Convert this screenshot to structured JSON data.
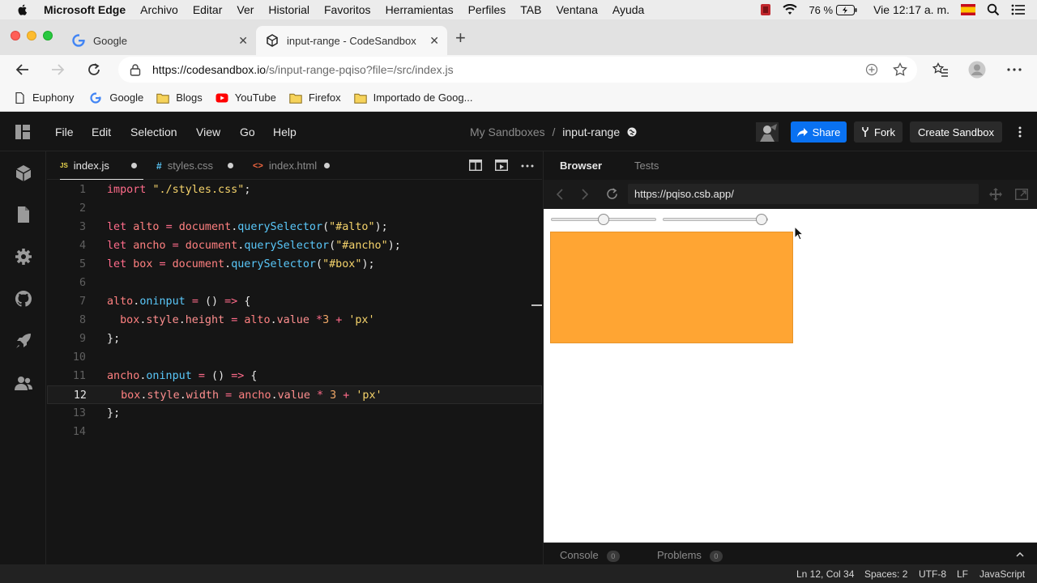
{
  "os_menubar": {
    "app_name": "Microsoft Edge",
    "items": [
      "Archivo",
      "Editar",
      "Ver",
      "Historial",
      "Favoritos",
      "Herramientas",
      "Perfiles",
      "TAB",
      "Ventana",
      "Ayuda"
    ],
    "battery": "76 %",
    "clock": "Vie 12:17 a. m."
  },
  "browser": {
    "tabs": [
      {
        "title": "Google",
        "active": false
      },
      {
        "title": "input-range - CodeSandbox",
        "active": true
      }
    ],
    "url_host": "https://codesandbox.io",
    "url_path": "/s/input-range-pqiso?file=/src/index.js",
    "bookmarks": [
      "Euphony",
      "Google",
      "Blogs",
      "YouTube",
      "Firefox",
      "Importado de Goog..."
    ]
  },
  "codesandbox": {
    "menu": [
      "File",
      "Edit",
      "Selection",
      "View",
      "Go",
      "Help"
    ],
    "breadcrumb_parent": "My Sandboxes",
    "breadcrumb_sep": "/",
    "sandbox_name": "input-range",
    "share_label": "Share",
    "fork_label": "Fork",
    "create_label": "Create Sandbox",
    "accent": "#0971f1"
  },
  "editor": {
    "tabs": [
      {
        "icon": "JS",
        "name": "index.js",
        "active": true
      },
      {
        "icon": "#",
        "name": "styles.css",
        "active": false
      },
      {
        "icon": "<>",
        "name": "index.html",
        "active": false
      }
    ],
    "current_line": 12,
    "lines": [
      "import \"./styles.css\";",
      "",
      "let alto = document.querySelector(\"#alto\");",
      "let ancho = document.querySelector(\"#ancho\");",
      "let box = document.querySelector(\"#box\");",
      "",
      "alto.oninput = () => {",
      "  box.style.height = alto.value *3 + 'px'",
      "};",
      "",
      "ancho.oninput = () => {",
      "  box.style.width = ancho.value * 3 + 'px'",
      "};",
      ""
    ]
  },
  "preview": {
    "tabs": [
      "Browser",
      "Tests"
    ],
    "url": "https://pqiso.csb.app/",
    "box_color": "#ffa533",
    "slider_alto_fraction": 0.5,
    "slider_ancho_fraction": 1.0,
    "console_label": "Console",
    "console_count": "0",
    "problems_label": "Problems",
    "problems_count": "0"
  },
  "statusbar": {
    "position": "Ln 12, Col 34",
    "spaces": "Spaces: 2",
    "encoding": "UTF-8",
    "eol": "LF",
    "language": "JavaScript"
  }
}
